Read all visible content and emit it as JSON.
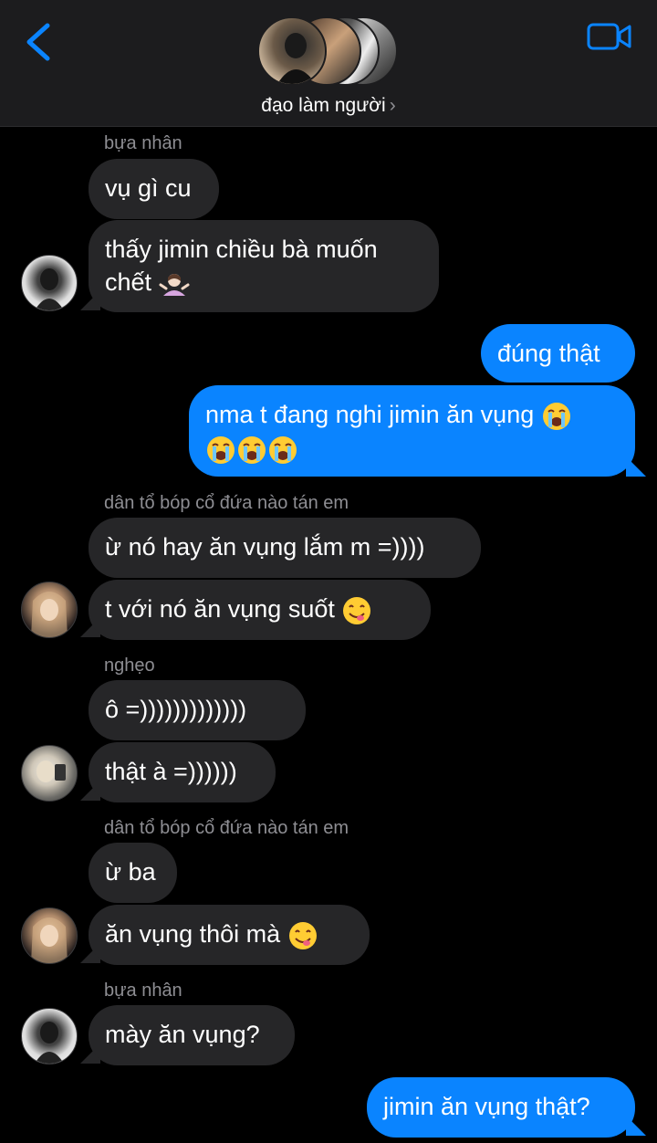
{
  "header": {
    "group_name": "đạo làm người",
    "chevron": "›",
    "back_icon": "chevron-left-icon",
    "video_icon": "video-camera-icon",
    "accent": "#0a84ff"
  },
  "messages": {
    "s1": "bựa nhân",
    "m1": "vụ gì cu",
    "m2a": "thấy jimin chiều bà muốn",
    "m2b": "chết",
    "m3": "đúng thật",
    "m4a": "nma t đang nghi jimin ăn vụng",
    "s2": "dân tổ bóp cổ đứa nào tán em",
    "m5": "ừ nó hay ăn vụng lắm m =))))",
    "m6": "t với nó ăn vụng suốt",
    "s3": "nghẹo",
    "m7": "ô =)))))))))))))",
    "m8": "thật à =))))))",
    "s4": "dân tổ bóp cổ đứa nào tán em",
    "m9": "ừ ba",
    "m10": "ăn vụng thôi mà",
    "s5": "bựa nhân",
    "m11": "mày ăn vụng?",
    "m12": "jimin ăn vụng thật?"
  },
  "colors": {
    "incoming_bubble": "#262628",
    "outgoing_bubble": "#0a84ff",
    "sender_name": "#8e8e93",
    "background": "#000000"
  },
  "icons": {
    "shrug": "person-shrugging-emoji",
    "crying": "loudly-crying-face-emoji",
    "yum": "face-savoring-food-emoji"
  }
}
